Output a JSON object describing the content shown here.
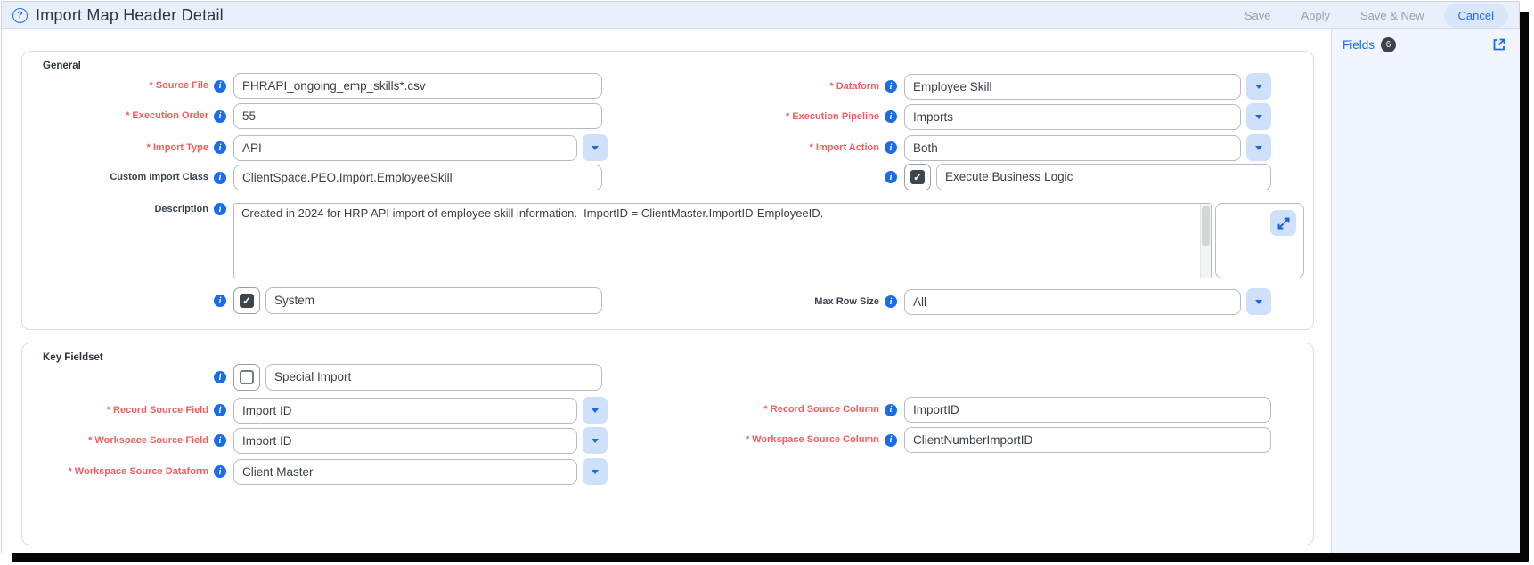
{
  "header": {
    "title": "Import Map Header Detail",
    "buttons": {
      "save": "Save",
      "apply": "Apply",
      "save_and_new": "Save & New",
      "cancel": "Cancel"
    }
  },
  "sidebar": {
    "fields_label": "Fields",
    "fields_count": "6"
  },
  "general": {
    "title": "General",
    "source_file": {
      "label": "* Source File",
      "value": "PHRAPI_ongoing_emp_skills*.csv"
    },
    "execution_order": {
      "label": "* Execution Order",
      "value": "55"
    },
    "import_type": {
      "label": "* Import Type",
      "value": "API"
    },
    "custom_import_class": {
      "label": "Custom Import Class",
      "value": "ClientSpace.PEO.Import.EmployeeSkill"
    },
    "description": {
      "label": "Description",
      "value": "Created in 2024 for HRP API import of employee skill information.  ImportID = ClientMaster.ImportID-EmployeeID."
    },
    "dataform": {
      "label": "* Dataform",
      "value": "Employee Skill"
    },
    "execution_pipeline": {
      "label": "* Execution Pipeline",
      "value": "Imports"
    },
    "import_action": {
      "label": "* Import Action",
      "value": "Both"
    },
    "execute_business_logic": {
      "label": "Execute Business Logic",
      "checked": true
    },
    "system": {
      "label": "System",
      "checked": true
    },
    "max_row_size": {
      "label": "Max Row Size",
      "value": "All"
    }
  },
  "key_fieldset": {
    "title": "Key Fieldset",
    "special_import": {
      "label": "Special Import",
      "checked": false
    },
    "record_source_field": {
      "label": "* Record Source Field",
      "value": "Import ID"
    },
    "workspace_source_field": {
      "label": "* Workspace Source Field",
      "value": "Import ID"
    },
    "workspace_source_dataform": {
      "label": "* Workspace Source Dataform",
      "value": "Client Master"
    },
    "record_source_column": {
      "label": "* Record Source Column",
      "value": "ImportID"
    },
    "workspace_source_column": {
      "label": "* Workspace Source Column",
      "value": "ClientNumberImportID"
    }
  },
  "colors": {
    "accent_blue": "#1a6ce8",
    "required_label_red": "#f25f5d",
    "header_bg": "#eaf0fb",
    "dropdown_bg": "#cfe0fa",
    "cancel_bg": "#d9e6fb",
    "badge_bg": "#3e434b"
  }
}
